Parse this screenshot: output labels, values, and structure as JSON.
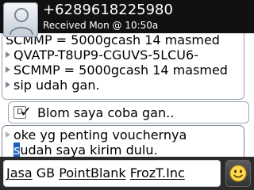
{
  "header": {
    "contact_number": "+6289618225980",
    "received_time": "Received Mon @ 10:50a",
    "avatar_icon": "contact-avatar-icon"
  },
  "messages": [
    {
      "direction": "incoming",
      "lines": [
        "SCMMP = 5000gcash 14 masmed",
        "QVATP-T8UP9-CGUVS-5LCU6-",
        "SCMMP = 5000gcash 14 masmed",
        "sip udah gan."
      ]
    },
    {
      "direction": "outgoing",
      "status_badge": "D",
      "check": "✓",
      "text": "Blom saya coba gan.."
    },
    {
      "direction": "incoming",
      "line1": "oke yg penting vouchernya",
      "line2_cursor_char": "s",
      "line2_rest": "udah saya kirim dulu."
    }
  ],
  "compose": {
    "word1": "Jasa",
    "word2": "GB",
    "word3": "PointBlank",
    "word4": "FrozT.Inc",
    "emoticon_icon": "smiley-icon"
  },
  "colors": {
    "header_bg": "#111111",
    "cursor_highlight": "#1f5fbf",
    "bubble_border": "#9aa3ad"
  }
}
